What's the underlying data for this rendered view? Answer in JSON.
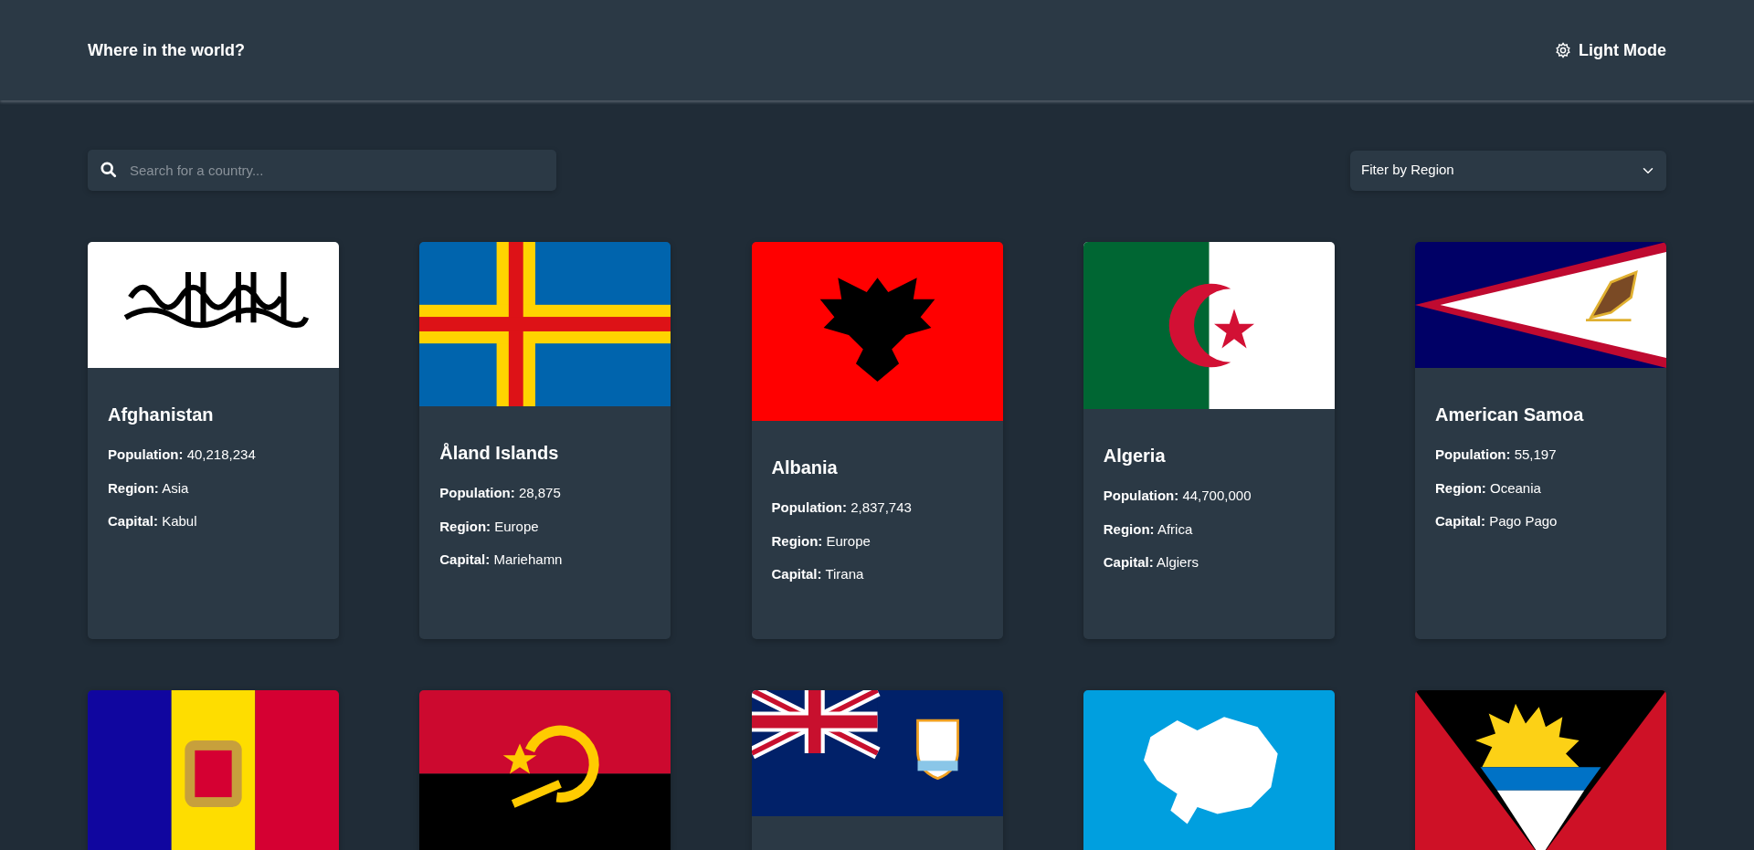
{
  "header": {
    "title": "Where in the world?",
    "theme_toggle": "Light Mode"
  },
  "search": {
    "placeholder": "Search for a country..."
  },
  "region_filter": {
    "value": "Fiter by Region"
  },
  "cards": [
    {
      "kind": "emirate",
      "name": "Afghanistan",
      "fields": [
        {
          "label": "Population:",
          "value": "40,218,234"
        },
        {
          "label": "Region:",
          "value": "Asia"
        },
        {
          "label": "Capital:",
          "value": "Kabul"
        }
      ]
    },
    {
      "kind": "cross",
      "name": "Åland Islands",
      "fields": [
        {
          "label": "Population:",
          "value": "28,875"
        },
        {
          "label": "Region:",
          "value": "Europe"
        },
        {
          "label": "Capital:",
          "value": "Mariehamn"
        }
      ]
    },
    {
      "kind": "eagle",
      "name": "Albania",
      "fields": [
        {
          "label": "Population:",
          "value": "2,837,743"
        },
        {
          "label": "Region:",
          "value": "Europe"
        },
        {
          "label": "Capital:",
          "value": "Tirana"
        }
      ]
    },
    {
      "kind": "crescent",
      "name": "Algeria",
      "fields": [
        {
          "label": "Population:",
          "value": "44,700,000"
        },
        {
          "label": "Region:",
          "value": "Africa"
        },
        {
          "label": "Capital:",
          "value": "Algiers"
        }
      ]
    },
    {
      "kind": "triangle",
      "name": "American Samoa",
      "fields": [
        {
          "label": "Population:",
          "value": "55,197"
        },
        {
          "label": "Region:",
          "value": "Oceania"
        },
        {
          "label": "Capital:",
          "value": "Pago Pago"
        }
      ]
    },
    {
      "kind": "tricolor"
    },
    {
      "kind": "bicolor"
    },
    {
      "kind": "ensign"
    },
    {
      "kind": "continent"
    },
    {
      "kind": "sunrise"
    }
  ]
}
